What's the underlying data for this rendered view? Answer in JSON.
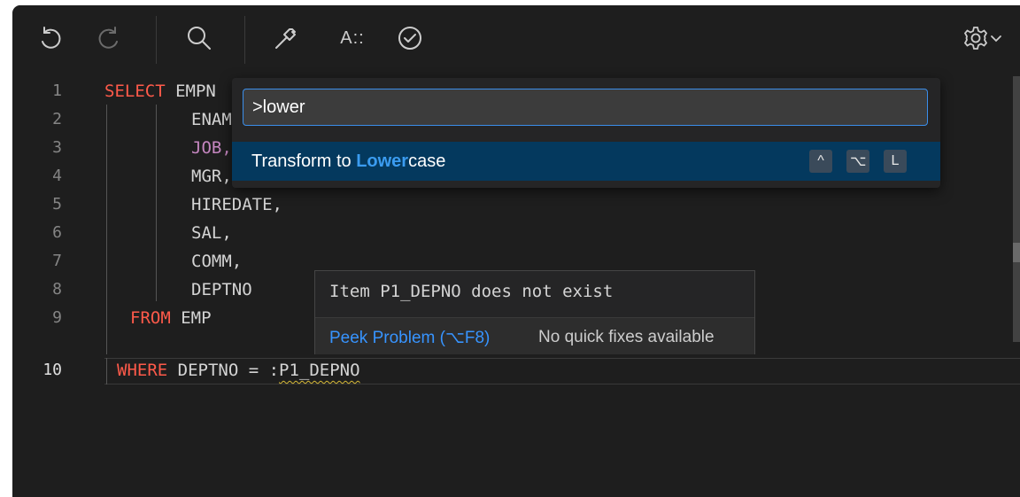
{
  "toolbar": {
    "icons": [
      "undo-icon",
      "redo-icon",
      "search-icon",
      "hammer-icon",
      "font-icon",
      "check-circle-icon",
      "gear-icon",
      "chevron-down-icon"
    ],
    "font_label": "A::"
  },
  "palette": {
    "input_value": ">lower",
    "item_prefix": "Transform to ",
    "item_match": "Lower",
    "item_suffix": "case",
    "keys": [
      "^",
      "⌥",
      "L"
    ]
  },
  "code": {
    "line_numbers": [
      "1",
      "2",
      "3",
      "4",
      "5",
      "6",
      "7",
      "8",
      "9",
      "10"
    ],
    "l1_kw": "SELECT",
    "l1_text": " EMPN",
    "l2_text": "ENAM",
    "l3_text": "JOB,",
    "l4_text": "MGR,",
    "l5_text": "HIREDATE,",
    "l6_text": "SAL,",
    "l7_text": "COMM,",
    "l8_text": "DEPTNO",
    "l9_kw": "FROM",
    "l9_text": " EMP",
    "l10_kw": "WHERE",
    "l10_text": " DEPTNO = :",
    "l10_bind": "P1_DEPNO"
  },
  "hover": {
    "message": "Item P1_DEPNO does not exist",
    "peek_label": "Peek Problem (⌥F8)",
    "no_fix_label": "No quick fixes available"
  },
  "colors": {
    "keyword": "#ff5a4a",
    "accent": "#3b8eea",
    "link": "#3794ff",
    "warning": "#d7ba37"
  }
}
